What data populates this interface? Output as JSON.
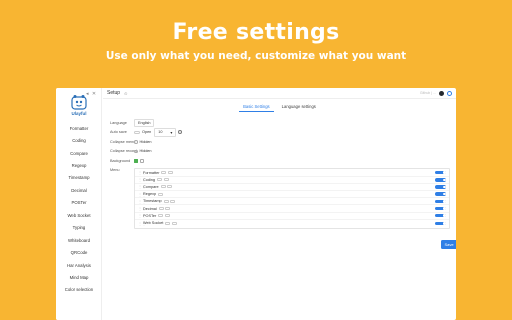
{
  "hero": {
    "title": "Free settings",
    "subtitle": "Use only what you need, customize what you want"
  },
  "sidebar": {
    "logo_text": "Ulayful",
    "items": [
      {
        "label": "Formatter"
      },
      {
        "label": "Coding"
      },
      {
        "label": "Compare"
      },
      {
        "label": "Regexp"
      },
      {
        "label": "Timestamp"
      },
      {
        "label": "Decimal"
      },
      {
        "label": "POSTer"
      },
      {
        "label": "Web Socket"
      },
      {
        "label": "Typing"
      },
      {
        "label": "Whiteboard"
      },
      {
        "label": "QRCode"
      },
      {
        "label": "Har Analysis"
      },
      {
        "label": "Mind Map"
      },
      {
        "label": "Color selection"
      }
    ]
  },
  "topbar": {
    "title": "Setup",
    "badge": "⊙",
    "right_text": "Github | ..."
  },
  "tabs": [
    {
      "label": "Basic Settings",
      "active": true
    },
    {
      "label": "Language settings",
      "active": false
    }
  ],
  "form": {
    "language_label": "Language",
    "language_value": "English",
    "auto_save_label": "Auto save",
    "auto_save_value": "Open",
    "auto_save_seconds": "10",
    "collapse_menu_label": "Collapse menu",
    "collapse_menu_value": "Hidden",
    "collapse_record_label": "Collapse record",
    "collapse_record_value": "Hidden",
    "background_label": "Background",
    "menu_label": "Menu"
  },
  "menu_items": [
    {
      "label": "Formatter"
    },
    {
      "label": "Coding"
    },
    {
      "label": "Compare"
    },
    {
      "label": "Regexp"
    },
    {
      "label": "Timestamp"
    },
    {
      "label": "Decimal"
    },
    {
      "label": "POSTer"
    },
    {
      "label": "Web Socket"
    }
  ],
  "save_label": "Save",
  "colors": {
    "background": "#F8B532",
    "accent": "#2f7fe6",
    "logo": "#2a6fb7"
  }
}
